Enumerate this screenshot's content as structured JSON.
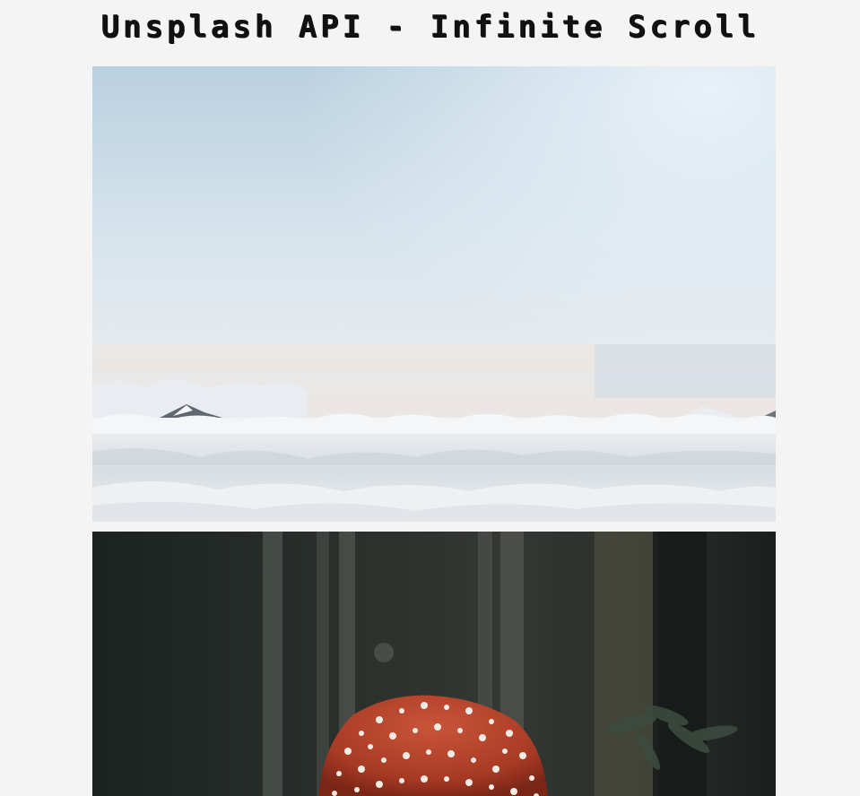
{
  "header": {
    "title": "Unsplash API - Infinite Scroll"
  },
  "photos": [
    {
      "alt": "Sea of clouds above snowy mountain peaks",
      "icon": "photo-clouds"
    },
    {
      "alt": "Red fly agaric mushroom in a dark forest",
      "icon": "photo-mushroom"
    }
  ],
  "colors": {
    "background": "#f4f4f4",
    "title": "#111111",
    "sky_top": "#b7cfe0",
    "mushroom_cap": "#b8432a",
    "forest_dark": "#1d2321"
  }
}
